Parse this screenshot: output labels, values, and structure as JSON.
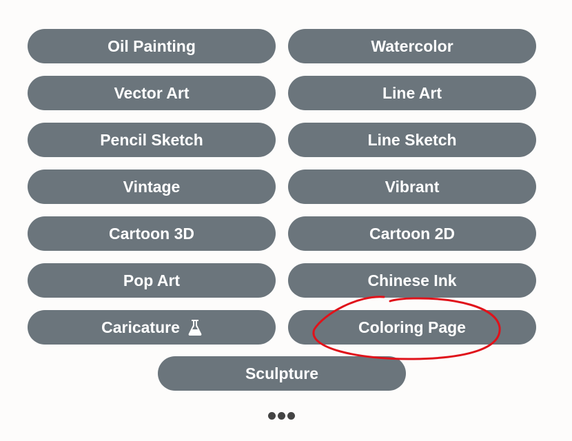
{
  "styles": [
    {
      "label": "Oil Painting"
    },
    {
      "label": "Watercolor"
    },
    {
      "label": "Vector Art"
    },
    {
      "label": "Line Art"
    },
    {
      "label": "Pencil Sketch"
    },
    {
      "label": "Line Sketch"
    },
    {
      "label": "Vintage"
    },
    {
      "label": "Vibrant"
    },
    {
      "label": "Cartoon 3D"
    },
    {
      "label": "Cartoon 2D"
    },
    {
      "label": "Pop Art"
    },
    {
      "label": "Chinese Ink"
    },
    {
      "label": "Caricature",
      "icon": "flask-icon"
    },
    {
      "label": "Coloring Page",
      "highlighted": true
    },
    {
      "label": "Sculpture"
    }
  ],
  "more_icon": "ellipsis-icon",
  "colors": {
    "button": "#6b757c",
    "annotation": "#e0121a",
    "background": "#fdfcfb"
  }
}
